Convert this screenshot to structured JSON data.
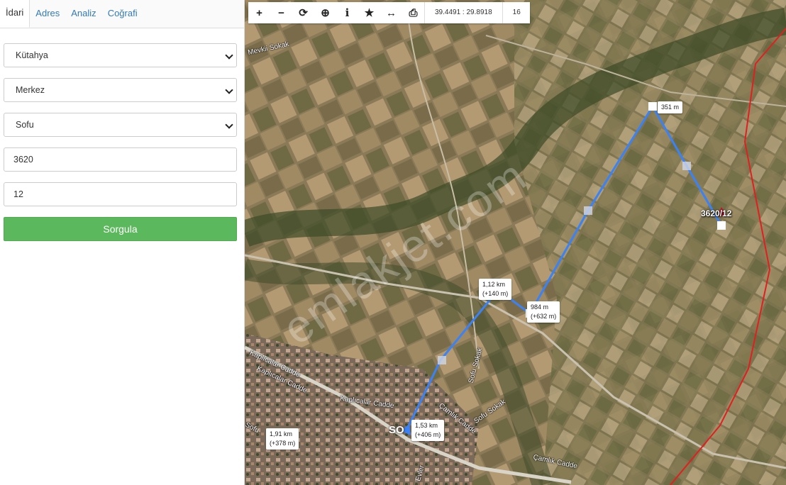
{
  "tabs": [
    {
      "label": "İdari",
      "active": true
    },
    {
      "label": "Adres",
      "active": false
    },
    {
      "label": "Analiz",
      "active": false
    },
    {
      "label": "Coğrafi",
      "active": false
    }
  ],
  "form": {
    "province": "Kütahya",
    "district": "Merkez",
    "neighborhood": "Sofu",
    "block": "3620",
    "parcel": "12",
    "query_label": "Sorgula"
  },
  "toolbar": {
    "icons": [
      "zoom-in-icon",
      "zoom-out-icon",
      "refresh-icon",
      "locate-icon",
      "info-icon",
      "favorite-icon",
      "measure-icon",
      "print-icon"
    ],
    "coordinates": "39.4491 : 29.8918",
    "zoom": "16"
  },
  "map": {
    "measurements": [
      {
        "line1": "351 m",
        "line2": ""
      },
      {
        "line1": "984 m",
        "line2": "(+632 m)"
      },
      {
        "line1": "1,12 km",
        "line2": "(+140 m)"
      },
      {
        "line1": "1,53 km",
        "line2": "(+406 m)"
      },
      {
        "line1": "1,91 km",
        "line2": "(+378 m)"
      }
    ],
    "parcel_label": "3620/12",
    "village_label": "SO",
    "streets": [
      "Kaplıcalar Cadde",
      "Kaplıcalar Cadde",
      "Kaplıcalar Cadde",
      "Çamlık Cadde",
      "Çamlık Cadde",
      "Sofu Sokak",
      "Sofu Sokak",
      "Mevkii Sokak",
      "Sofu",
      "Evler"
    ],
    "watermark": "emlakjet.com",
    "colors": {
      "measure_line": "#3b82f6",
      "parcel_boundary": "#e02020",
      "query_button": "#5cb85c"
    }
  }
}
